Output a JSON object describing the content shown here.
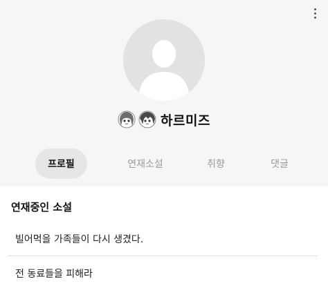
{
  "profile": {
    "nickname": "하르미즈",
    "avatar_icon": "default-user-silhouette-icon",
    "badges": [
      {
        "icon": "character-badge-icon-1"
      },
      {
        "icon": "character-badge-icon-2"
      }
    ]
  },
  "header": {
    "more_icon": "more-vertical-icon"
  },
  "tabs": [
    {
      "label": "프로필",
      "active": true
    },
    {
      "label": "연재소설",
      "active": false
    },
    {
      "label": "취향",
      "active": false
    },
    {
      "label": "댓글",
      "active": false
    }
  ],
  "section": {
    "title": "연재중인 소설"
  },
  "novels": [
    {
      "title": "빌어먹을 가족들이 다시 생겼다."
    },
    {
      "title": "전 동료들을 피해라"
    }
  ],
  "colors": {
    "header_bg": "#f6f6f6",
    "active_tab_bg": "#e6e6e6",
    "inactive_tab_text": "#9a9a9a",
    "avatar_bg": "#e2e2e2"
  }
}
